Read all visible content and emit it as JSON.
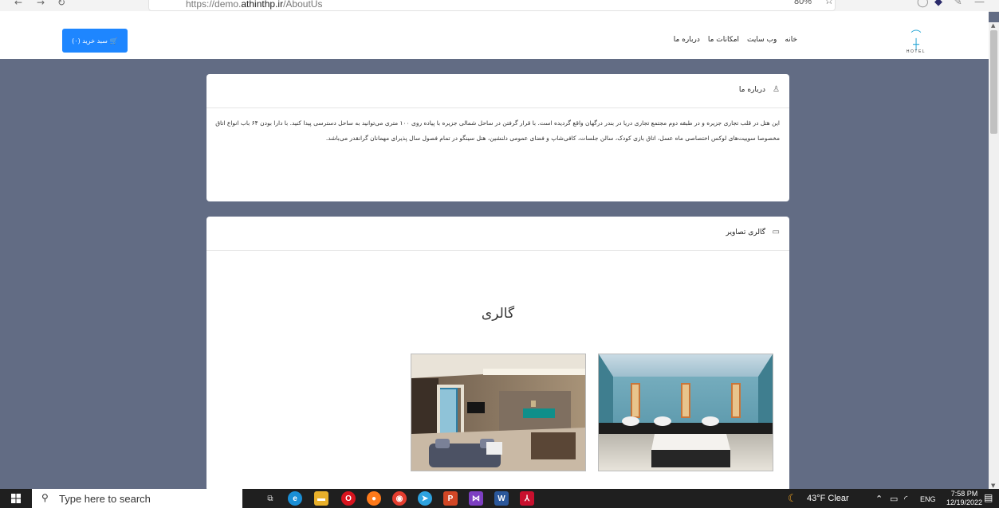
{
  "browser": {
    "url_prefix": "https://demo.",
    "url_domain": "athinthp.ir",
    "url_path": "/AboutUs",
    "zoom": "80%"
  },
  "header": {
    "cart_label": "سبد خرید (۰)",
    "menu": [
      "خانه",
      "وب سایت",
      "امکانات ما",
      "درباره ما"
    ],
    "logo_text": "HOTEL"
  },
  "about": {
    "title": "درباره ما",
    "body": "این هتل در قلب تجاری جزیره و در طبقه دوم مجتمع تجاری دریا در بندر درگهان واقع گردیده است. با قرار گرفتن در ساحل شمالی جزیره با پیاده روی ۱۰۰ متری می‌توانید به ساحل دسترسی پیدا کنید. با دارا بودن ۶۴ باب انواع اتاق مخصوصا سوییت‌های لوکس اختصاصی ماه عسل، اتاق بازی کودک، سالن جلسات، کافی‌شاپ و فضای عمومی دلنشین، هتل سینگو در تمام فصول سال پذیرای مهمانان گرانقدر می‌باشد."
  },
  "gallery": {
    "title": "گالری تصاویر",
    "heading": "گالری"
  },
  "taskbar": {
    "search_placeholder": "Type here to search",
    "weather": "43°F  Clear",
    "lang": "ENG",
    "time": "7:58 PM",
    "date": "12/19/2022"
  },
  "colors": {
    "page_bg": "#626c84",
    "accent": "#1e86ff",
    "taskbar": "#1f1f1f"
  }
}
